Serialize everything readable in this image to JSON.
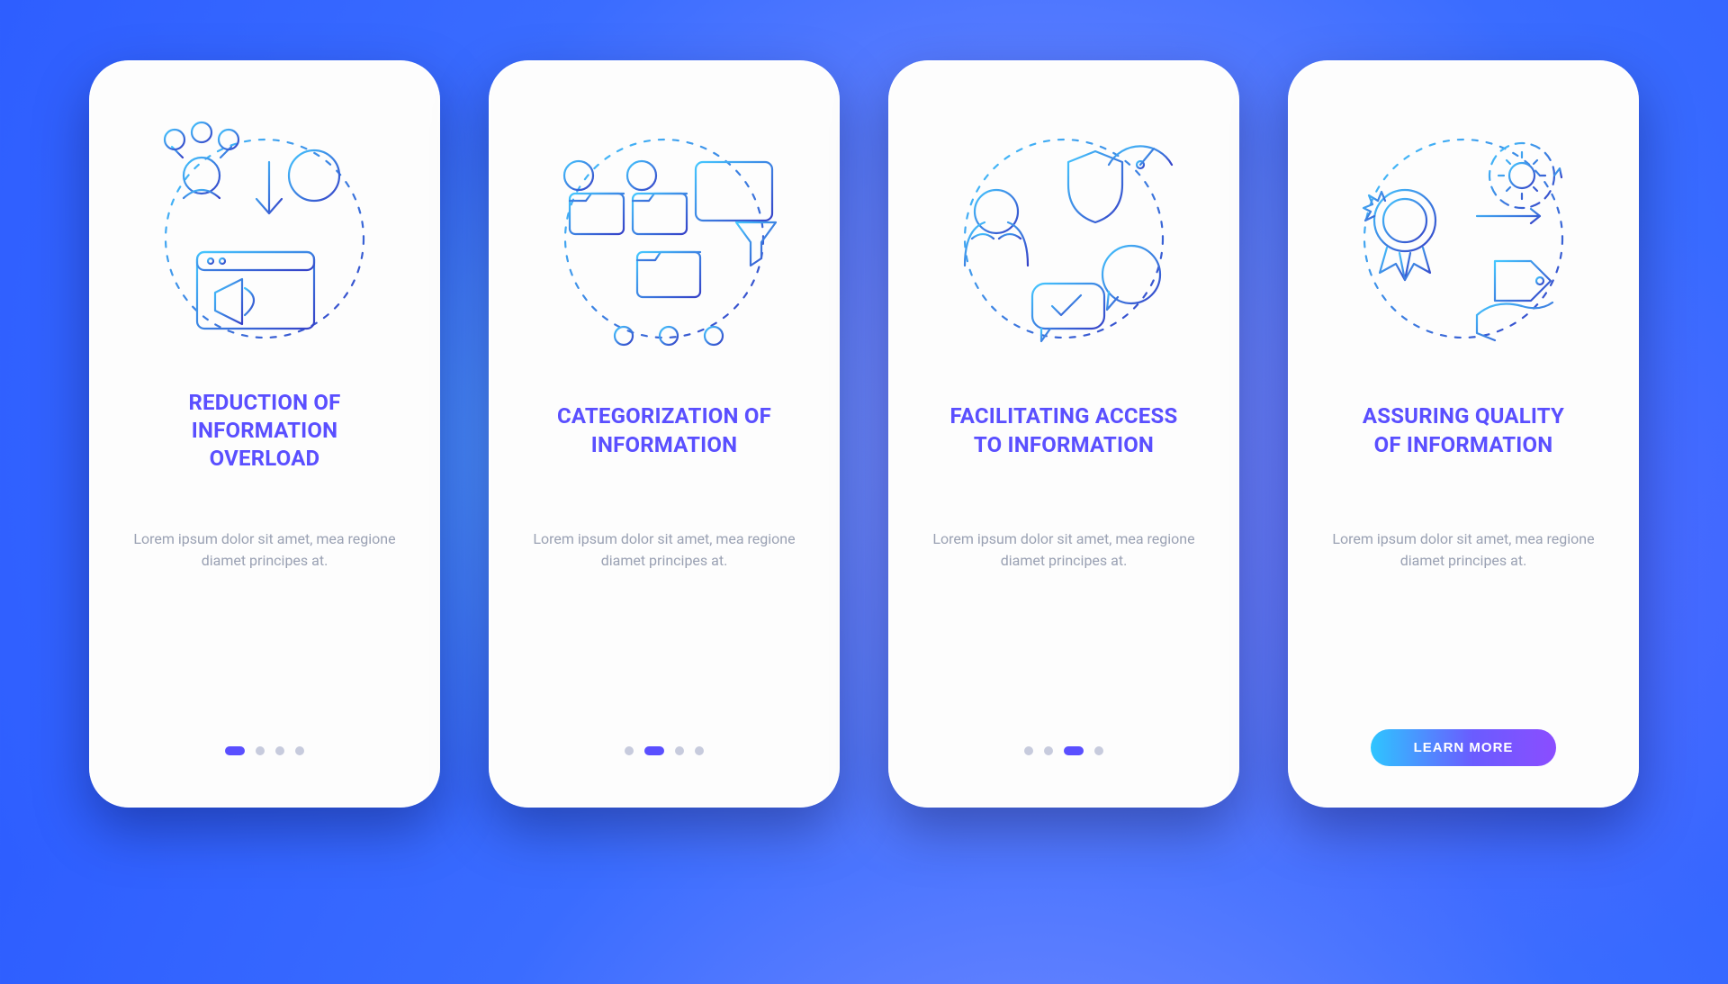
{
  "colors": {
    "title": "#5a4fff",
    "body": "#9aa1b3",
    "dot": "#c7cbdd",
    "dot_active": "#5a4fff",
    "cta_gradient_start": "#2ec5ff",
    "cta_gradient_mid": "#6a5cff",
    "cta_gradient_end": "#8b4dff",
    "stroke_light": "#45c8ff",
    "stroke_dark": "#3540c7"
  },
  "cta_label": "LEARN MORE",
  "body_text": "Lorem ipsum dolor sit amet, mea regione diamet principes at.",
  "screens": [
    {
      "title": "REDUCTION OF\nINFORMATION\nOVERLOAD",
      "icon": "reduction-icon",
      "active_index": 0,
      "show_cta": false
    },
    {
      "title": "CATEGORIZATION OF\nINFORMATION",
      "icon": "categorization-icon",
      "active_index": 1,
      "show_cta": false
    },
    {
      "title": "FACILITATING ACCESS\nTO INFORMATION",
      "icon": "facilitating-icon",
      "active_index": 2,
      "show_cta": false
    },
    {
      "title": "ASSURING QUALITY\nOF INFORMATION",
      "icon": "assuring-icon",
      "active_index": 3,
      "show_cta": true
    }
  ],
  "total_dots": 4
}
